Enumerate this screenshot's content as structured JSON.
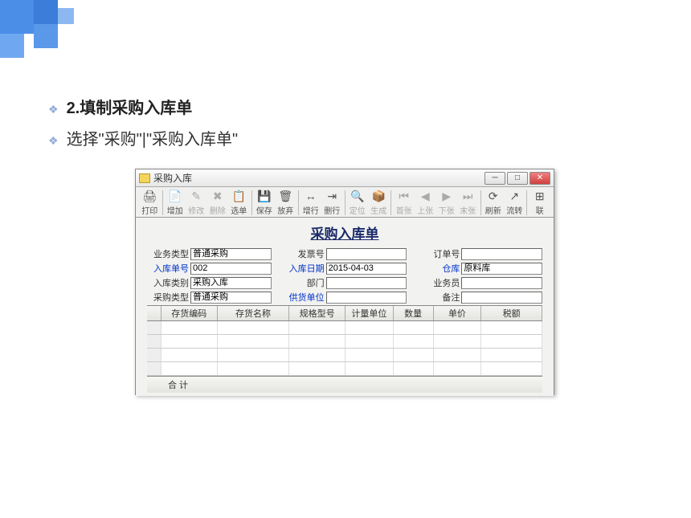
{
  "slide": {
    "heading": "2.填制采购入库单",
    "subtext": "选择\"采购\"|\"采购入库单\""
  },
  "window": {
    "title": "采购入库"
  },
  "toolbar": [
    {
      "label": "打印",
      "icon": "🖨"
    },
    {
      "label": "增加",
      "icon": "📄"
    },
    {
      "label": "修改",
      "icon": "✎"
    },
    {
      "label": "删除",
      "icon": "✖"
    },
    {
      "label": "选单",
      "icon": "📋"
    },
    {
      "label": "保存",
      "icon": "💾"
    },
    {
      "label": "放弃",
      "icon": "🗑"
    },
    {
      "label": "增行",
      "icon": "↔"
    },
    {
      "label": "删行",
      "icon": "⇥"
    },
    {
      "label": "定位",
      "icon": "🔍"
    },
    {
      "label": "生成",
      "icon": "📦"
    },
    {
      "label": "首张",
      "icon": "⏮"
    },
    {
      "label": "上张",
      "icon": "◀"
    },
    {
      "label": "下张",
      "icon": "▶"
    },
    {
      "label": "末张",
      "icon": "⏭"
    },
    {
      "label": "刷新",
      "icon": "⟳"
    },
    {
      "label": "流转",
      "icon": "↗"
    },
    {
      "label": "联",
      "icon": "⊞"
    }
  ],
  "form": {
    "title": "采购入库单",
    "fields": {
      "business_type": {
        "label": "业务类型",
        "value": "普通采购"
      },
      "invoice_no": {
        "label": "发票号",
        "value": ""
      },
      "order_no": {
        "label": "订单号",
        "value": ""
      },
      "entry_no": {
        "label": "入库单号",
        "value": "002"
      },
      "entry_date": {
        "label": "入库日期",
        "value": "2015-04-03"
      },
      "warehouse": {
        "label": "仓库",
        "value": "原料库"
      },
      "entry_type": {
        "label": "入库类别",
        "value": "采购入库"
      },
      "department": {
        "label": "部门",
        "value": ""
      },
      "operator": {
        "label": "业务员",
        "value": ""
      },
      "purchase_type": {
        "label": "采购类型",
        "value": "普通采购"
      },
      "supplier": {
        "label": "供货单位",
        "value": ""
      },
      "remark": {
        "label": "备注",
        "value": ""
      }
    }
  },
  "table": {
    "columns": [
      "存货编码",
      "存货名称",
      "规格型号",
      "计量单位",
      "数量",
      "单价",
      "税额"
    ],
    "widths": [
      70,
      90,
      70,
      60,
      50,
      60,
      76
    ],
    "rows": 4,
    "footer": "合  计"
  }
}
